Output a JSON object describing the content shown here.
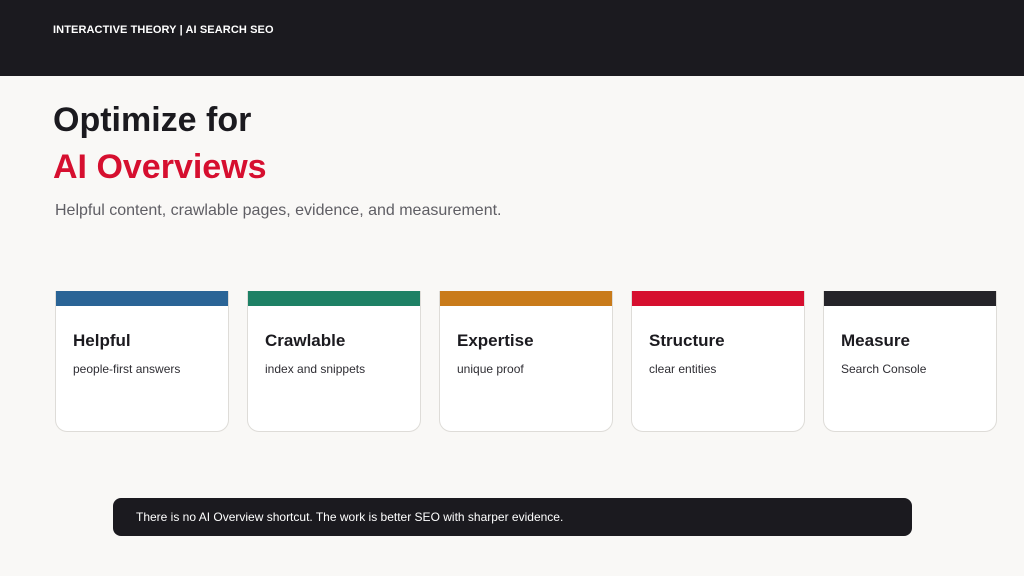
{
  "header": {
    "brand": "INTERACTIVE THEORY | AI SEARCH SEO"
  },
  "hero": {
    "title_line1": "Optimize for",
    "title_line2": "AI Overviews",
    "subtitle": "Helpful content, crawlable pages, evidence, and measurement."
  },
  "cards": [
    {
      "title": "Helpful",
      "description": "people-first answers",
      "accent_color": "#2a6496"
    },
    {
      "title": "Crawlable",
      "description": "index and snippets",
      "accent_color": "#1e8165"
    },
    {
      "title": "Expertise",
      "description": "unique proof",
      "accent_color": "#c97b1a"
    },
    {
      "title": "Structure",
      "description": "clear entities",
      "accent_color": "#d60f2f"
    },
    {
      "title": "Measure",
      "description": "Search Console",
      "accent_color": "#252429"
    }
  ],
  "footer": {
    "note": "There is no AI Overview shortcut. The work is better SEO with sharper evidence."
  },
  "colors": {
    "background": "#f9f8f6",
    "dark": "#1b1a1f",
    "highlight": "#d60f2f"
  }
}
